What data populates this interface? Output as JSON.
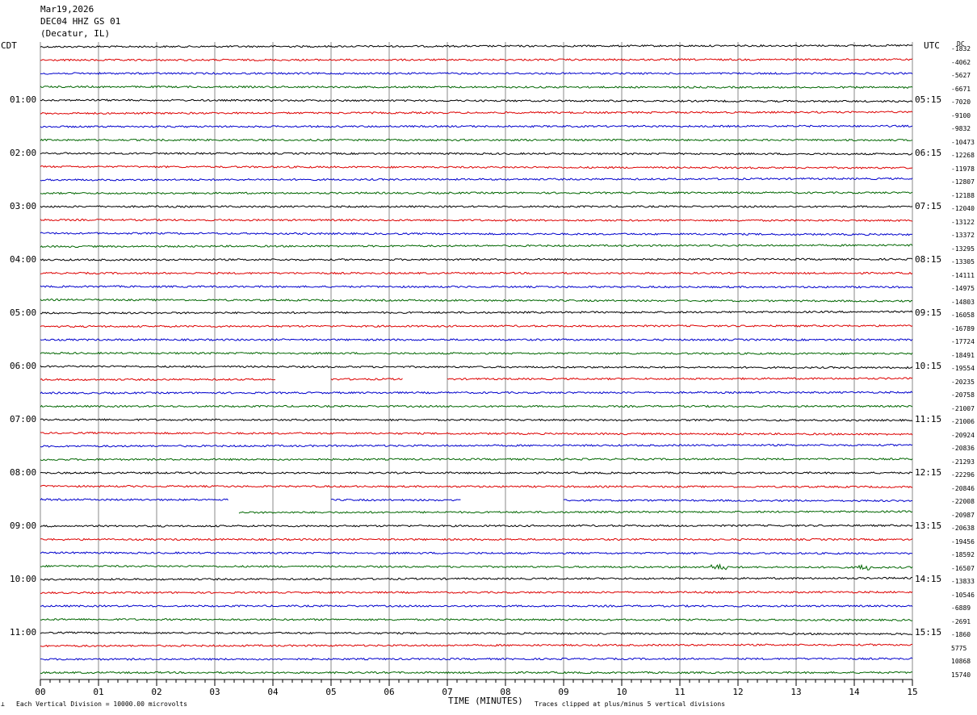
{
  "header": {
    "date": "Mar19,2026",
    "station": "DEC04 HHZ GS 01",
    "location": "(Decatur, IL)"
  },
  "left_zone": "CDT",
  "right_zone": "UTC",
  "dc_label": "DC",
  "footer": {
    "scale_note": "Each Vertical Division = 10000.00 microvolts",
    "x_title": "TIME (MINUTES)",
    "clip_note": "Traces clipped at plus/minus 5 vertical divisions"
  },
  "chart_data": {
    "type": "line",
    "title": "DEC04 HHZ GS 01",
    "xlabel": "TIME (MINUTES)",
    "xlim": [
      0,
      15
    ],
    "x_ticks": [
      "00",
      "01",
      "02",
      "03",
      "04",
      "05",
      "06",
      "07",
      "08",
      "09",
      "10",
      "11",
      "12",
      "13",
      "14",
      "15"
    ],
    "traces_per_hour": 4,
    "trace_colors": [
      "#000000",
      "#dd0000",
      "#0000cc",
      "#006600"
    ],
    "left_hour_labels": [
      "01:00",
      "02:00",
      "03:00",
      "04:00",
      "05:00",
      "06:00",
      "07:00",
      "08:00",
      "09:00",
      "10:00",
      "11:00"
    ],
    "right_hour_labels": [
      "05:15",
      "06:15",
      "07:15",
      "08:15",
      "09:15",
      "10:15",
      "11:15",
      "12:15",
      "13:15",
      "14:15",
      "15:15"
    ],
    "dc_offsets": [
      "-1832",
      "-4062",
      "-5627",
      "-6671",
      "-7020",
      "-9100",
      "-9832",
      "-10473",
      "-12268",
      "-11978",
      "-12807",
      "-12188",
      "-12040",
      "-13122",
      "-13372",
      "-13295",
      "-13305",
      "-14111",
      "-14975",
      "-14803",
      "-16058",
      "-16789",
      "-17724",
      "-18491",
      "-19554",
      "-20235",
      "-20758",
      "-21007",
      "-21006",
      "-20924",
      "-20836",
      "-21293",
      "-22296",
      "-20846",
      "-22008",
      "-20987",
      "-20638",
      "-19456",
      "-18592",
      "-16507",
      "-13833",
      "-10546",
      "-6889",
      "-2691",
      "-1860",
      "5775",
      "10868",
      "15740"
    ],
    "gaps": [
      {
        "trace": 25,
        "start_min": 4.05,
        "end_min": 5.0
      },
      {
        "trace": 25,
        "start_min": 6.25,
        "end_min": 7.0
      },
      {
        "trace": 34,
        "start_min": 3.25,
        "end_min": 5.0
      },
      {
        "trace": 34,
        "start_min": 7.25,
        "end_min": 9.0
      },
      {
        "trace": 35,
        "start_min": 0.0,
        "end_min": 3.4
      }
    ],
    "events": [
      {
        "trace": 39,
        "minute": 11.65
      },
      {
        "trace": 39,
        "minute": 14.2
      }
    ]
  }
}
